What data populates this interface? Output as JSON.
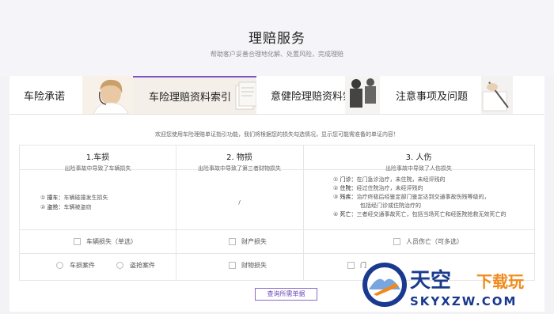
{
  "header": {
    "title": "理赔服务",
    "subtitle": "帮助客户妥善合理地化解、处置风险，完成理赔"
  },
  "tabs": [
    {
      "label": "车险承诺",
      "active": false
    },
    {
      "label": "车险理赔资料索引",
      "active": true
    },
    {
      "label": "意健险理赔资料索引",
      "active": false
    },
    {
      "label": "注意事项及问题",
      "active": false
    }
  ],
  "notice": "欢迎您使用车险理赔单证指引功能，我们将根据您的损失勾选情况，显示您可能需准备的单证内容！",
  "columns": [
    {
      "title": "1.车损",
      "subtitle": "出险事故中导致了车辆损失",
      "items": [
        {
          "num": "①",
          "label": "撞车：",
          "text": "车辆碰撞发生损失"
        },
        {
          "num": "②",
          "label": "盗抢：",
          "text": "车辆被盗窃"
        }
      ],
      "checkbox": "车辆损失（单选）",
      "options": [
        "车损案件",
        "盗抢案件"
      ]
    },
    {
      "title": "2. 物损",
      "subtitle": "出险事故中导致了第三者财物损失",
      "items_text": "/",
      "checkbox": "财产损失",
      "options": [
        "财物损失"
      ]
    },
    {
      "title": "3. 人伤",
      "subtitle": "出险事故中导致了人伤损失",
      "items": [
        {
          "num": "①",
          "label": "门诊：",
          "text": "在门急诊治疗，未住院，未经评残的"
        },
        {
          "num": "②",
          "label": "住院：",
          "text": "经过住院治疗，未经评残的"
        },
        {
          "num": "③",
          "label": "残疾：",
          "text": "治疗终极后经鉴定部门鉴定达到交通事故伤残等级的，"
        },
        {
          "num": "",
          "label": "",
          "text": "包括经门诊或住院治疗的"
        },
        {
          "num": "④",
          "label": "死亡：",
          "text": "三者经交通事故死亡，包括当场死亡和经医院抢救无效死亡的"
        }
      ],
      "checkbox": "人员伤亡（可多选）",
      "options": [
        "门"
      ]
    }
  ],
  "submit_label": "查询所需单据",
  "watermark": {
    "title": "天空",
    "accent": "下载玩",
    "url": "SKYXZW.COM"
  },
  "colors": {
    "accent": "#7b57c3",
    "watermark_blue": "#1a3a8f",
    "watermark_orange": "#f08a1c"
  }
}
